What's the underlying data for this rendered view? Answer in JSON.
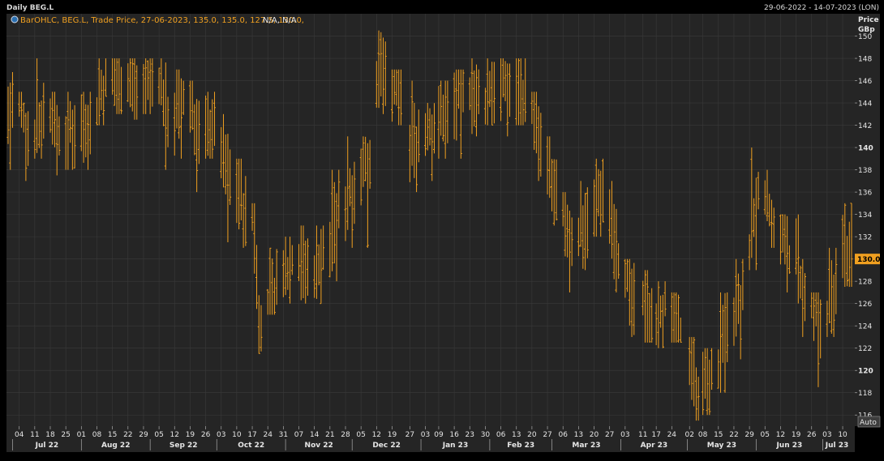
{
  "header": {
    "title": "Daily BEG.L",
    "date_range": "29-06-2022 - 14-07-2023 (LON)"
  },
  "legend": {
    "icon": "chart-settings-icon",
    "text": "BarOHLC, BEG.L, Trade Price, 27-06-2023, 135.0, 135.0, 127.5, 130.0,",
    "na_text": "N/A, N/A"
  },
  "price_axis": {
    "title": "Price",
    "unit": "GBp",
    "last_price_label": "130.0",
    "auto_button": "Auto",
    "bold_ticks": [
      120,
      140
    ]
  },
  "colors": {
    "background": "#000000",
    "plot_bg": "#252525",
    "grid": "#3a3a3a",
    "bar": "#f0a020",
    "text": "#d8d8d8",
    "last_price_bg": "#f0a020"
  },
  "chart_data": {
    "type": "ohlc",
    "title": "Daily BEG.L",
    "ylabel": "Price GBp",
    "ylim": [
      115,
      152
    ],
    "y_ticks": [
      116,
      118,
      120,
      122,
      124,
      126,
      128,
      130,
      132,
      134,
      136,
      138,
      140,
      142,
      144,
      146,
      148,
      150
    ],
    "last_price": 130.0,
    "x_start": "2022-06-29",
    "x_end": "2023-07-14",
    "day_ticks": [
      {
        "date": "2022-07-04",
        "label": "04"
      },
      {
        "date": "2022-07-11",
        "label": "11"
      },
      {
        "date": "2022-07-18",
        "label": "18"
      },
      {
        "date": "2022-07-25",
        "label": "25"
      },
      {
        "date": "2022-08-01",
        "label": "01"
      },
      {
        "date": "2022-08-08",
        "label": "08"
      },
      {
        "date": "2022-08-15",
        "label": "15"
      },
      {
        "date": "2022-08-22",
        "label": "22"
      },
      {
        "date": "2022-08-29",
        "label": "29"
      },
      {
        "date": "2022-09-05",
        "label": "05"
      },
      {
        "date": "2022-09-12",
        "label": "12"
      },
      {
        "date": "2022-09-19",
        "label": "19"
      },
      {
        "date": "2022-09-26",
        "label": "26"
      },
      {
        "date": "2022-10-03",
        "label": "03"
      },
      {
        "date": "2022-10-10",
        "label": "10"
      },
      {
        "date": "2022-10-17",
        "label": "17"
      },
      {
        "date": "2022-10-24",
        "label": "24"
      },
      {
        "date": "2022-10-31",
        "label": "31"
      },
      {
        "date": "2022-11-07",
        "label": "07"
      },
      {
        "date": "2022-11-14",
        "label": "14"
      },
      {
        "date": "2022-11-21",
        "label": "21"
      },
      {
        "date": "2022-11-28",
        "label": "28"
      },
      {
        "date": "2022-12-05",
        "label": "05"
      },
      {
        "date": "2022-12-12",
        "label": "12"
      },
      {
        "date": "2022-12-19",
        "label": "19"
      },
      {
        "date": "2022-12-27",
        "label": "27"
      },
      {
        "date": "2023-01-03",
        "label": "03"
      },
      {
        "date": "2023-01-09",
        "label": "09"
      },
      {
        "date": "2023-01-16",
        "label": "16"
      },
      {
        "date": "2023-01-23",
        "label": "23"
      },
      {
        "date": "2023-01-30",
        "label": "30"
      },
      {
        "date": "2023-02-06",
        "label": "06"
      },
      {
        "date": "2023-02-13",
        "label": "13"
      },
      {
        "date": "2023-02-20",
        "label": "20"
      },
      {
        "date": "2023-02-27",
        "label": "27"
      },
      {
        "date": "2023-03-06",
        "label": "06"
      },
      {
        "date": "2023-03-13",
        "label": "13"
      },
      {
        "date": "2023-03-20",
        "label": "20"
      },
      {
        "date": "2023-03-27",
        "label": "27"
      },
      {
        "date": "2023-04-03",
        "label": "03"
      },
      {
        "date": "2023-04-11",
        "label": "11"
      },
      {
        "date": "2023-04-17",
        "label": "17"
      },
      {
        "date": "2023-04-24",
        "label": "24"
      },
      {
        "date": "2023-05-02",
        "label": "02"
      },
      {
        "date": "2023-05-08",
        "label": "08"
      },
      {
        "date": "2023-05-15",
        "label": "15"
      },
      {
        "date": "2023-05-22",
        "label": "22"
      },
      {
        "date": "2023-05-29",
        "label": "29"
      },
      {
        "date": "2023-06-05",
        "label": "05"
      },
      {
        "date": "2023-06-12",
        "label": "12"
      },
      {
        "date": "2023-06-19",
        "label": "19"
      },
      {
        "date": "2023-06-26",
        "label": "26"
      },
      {
        "date": "2023-07-03",
        "label": "03"
      },
      {
        "date": "2023-07-10",
        "label": "10"
      }
    ],
    "month_ticks": [
      {
        "date": "2022-07-01",
        "label": "Jul 22"
      },
      {
        "date": "2022-08-01",
        "label": "Aug 22"
      },
      {
        "date": "2022-09-01",
        "label": "Sep 22"
      },
      {
        "date": "2022-10-01",
        "label": "Oct 22"
      },
      {
        "date": "2022-11-01",
        "label": "Nov 22"
      },
      {
        "date": "2022-12-01",
        "label": "Dec 22"
      },
      {
        "date": "2023-01-01",
        "label": "Jan 23"
      },
      {
        "date": "2023-02-01",
        "label": "Feb 23"
      },
      {
        "date": "2023-03-01",
        "label": "Mar 23"
      },
      {
        "date": "2023-04-01",
        "label": "Apr 23"
      },
      {
        "date": "2023-05-01",
        "label": "May 23"
      },
      {
        "date": "2023-06-01",
        "label": "Jun 23"
      },
      {
        "date": "2023-07-01",
        "label": "Jul 23"
      }
    ],
    "weekly_ohlc": [
      {
        "week": "2022-06-27",
        "open": 142,
        "high": 148,
        "low": 138,
        "close": 144
      },
      {
        "week": "2022-07-04",
        "open": 144,
        "high": 145,
        "low": 137,
        "close": 141
      },
      {
        "week": "2022-07-11",
        "open": 141,
        "high": 148,
        "low": 139,
        "close": 143
      },
      {
        "week": "2022-07-18",
        "open": 143,
        "high": 145,
        "low": 137.5,
        "close": 141
      },
      {
        "week": "2022-07-25",
        "open": 141,
        "high": 145,
        "low": 138,
        "close": 142
      },
      {
        "week": "2022-08-01",
        "open": 142,
        "high": 145,
        "low": 138,
        "close": 143
      },
      {
        "week": "2022-08-08",
        "open": 143,
        "high": 148,
        "low": 142,
        "close": 146
      },
      {
        "week": "2022-08-15",
        "open": 146,
        "high": 148,
        "low": 143,
        "close": 146
      },
      {
        "week": "2022-08-22",
        "open": 146,
        "high": 148,
        "low": 142.5,
        "close": 145
      },
      {
        "week": "2022-08-29",
        "open": 145,
        "high": 148,
        "low": 143,
        "close": 146
      },
      {
        "week": "2022-09-05",
        "open": 146,
        "high": 148,
        "low": 138,
        "close": 143
      },
      {
        "week": "2022-09-12",
        "open": 143,
        "high": 147,
        "low": 139,
        "close": 144
      },
      {
        "week": "2022-09-19",
        "open": 144,
        "high": 146,
        "low": 136,
        "close": 141
      },
      {
        "week": "2022-09-26",
        "open": 141,
        "high": 145,
        "low": 139,
        "close": 143
      },
      {
        "week": "2022-10-03",
        "open": 140,
        "high": 143,
        "low": 131.5,
        "close": 137
      },
      {
        "week": "2022-10-10",
        "open": 137,
        "high": 139,
        "low": 131,
        "close": 134
      },
      {
        "week": "2022-10-17",
        "open": 134,
        "high": 135,
        "low": 121.5,
        "close": 123
      },
      {
        "week": "2022-10-24",
        "open": 125,
        "high": 131,
        "low": 125,
        "close": 128
      },
      {
        "week": "2022-10-31",
        "open": 128,
        "high": 132,
        "low": 126,
        "close": 130
      },
      {
        "week": "2022-11-07",
        "open": 130,
        "high": 133,
        "low": 126,
        "close": 129
      },
      {
        "week": "2022-11-14",
        "open": 129,
        "high": 133,
        "low": 126,
        "close": 131
      },
      {
        "week": "2022-11-21",
        "open": 131,
        "high": 138,
        "low": 128,
        "close": 135
      },
      {
        "week": "2022-11-28",
        "open": 135,
        "high": 141,
        "low": 131,
        "close": 137
      },
      {
        "week": "2022-12-05",
        "open": 137,
        "high": 141,
        "low": 131,
        "close": 139
      },
      {
        "week": "2022-12-12",
        "open": 146,
        "high": 150.5,
        "low": 143,
        "close": 147
      },
      {
        "week": "2022-12-19",
        "open": 146,
        "high": 147,
        "low": 142,
        "close": 145
      },
      {
        "week": "2022-12-27",
        "open": 140,
        "high": 146,
        "low": 136,
        "close": 141
      },
      {
        "week": "2023-01-03",
        "open": 141,
        "high": 144,
        "low": 137,
        "close": 142
      },
      {
        "week": "2023-01-09",
        "open": 142,
        "high": 146,
        "low": 139,
        "close": 144
      },
      {
        "week": "2023-01-16",
        "open": 144,
        "high": 147,
        "low": 139,
        "close": 145
      },
      {
        "week": "2023-01-23",
        "open": 145,
        "high": 148,
        "low": 141,
        "close": 144
      },
      {
        "week": "2023-01-30",
        "open": 144,
        "high": 148,
        "low": 142,
        "close": 146
      },
      {
        "week": "2023-02-06",
        "open": 146,
        "high": 148,
        "low": 141,
        "close": 145
      },
      {
        "week": "2023-02-13",
        "open": 145,
        "high": 148,
        "low": 142,
        "close": 145
      },
      {
        "week": "2023-02-20",
        "open": 144,
        "high": 145,
        "low": 137,
        "close": 140
      },
      {
        "week": "2023-02-27",
        "open": 138,
        "high": 141,
        "low": 133,
        "close": 135
      },
      {
        "week": "2023-03-06",
        "open": 134,
        "high": 136,
        "low": 127,
        "close": 132
      },
      {
        "week": "2023-03-13",
        "open": 132,
        "high": 137,
        "low": 129,
        "close": 134
      },
      {
        "week": "2023-03-20",
        "open": 134,
        "high": 139,
        "low": 132,
        "close": 137
      },
      {
        "week": "2023-03-27",
        "open": 134,
        "high": 137,
        "low": 127,
        "close": 130
      },
      {
        "week": "2023-04-03",
        "open": 129,
        "high": 130,
        "low": 123,
        "close": 126
      },
      {
        "week": "2023-04-11",
        "open": 126,
        "high": 129,
        "low": 122.5,
        "close": 125
      },
      {
        "week": "2023-04-17",
        "open": 125,
        "high": 128,
        "low": 122,
        "close": 126
      },
      {
        "week": "2023-04-24",
        "open": 124,
        "high": 127,
        "low": 122.5,
        "close": 123
      },
      {
        "week": "2023-05-02",
        "open": 122,
        "high": 123,
        "low": 115.5,
        "close": 118
      },
      {
        "week": "2023-05-08",
        "open": 118,
        "high": 122,
        "low": 116,
        "close": 120
      },
      {
        "week": "2023-05-15",
        "open": 120,
        "high": 127,
        "low": 118,
        "close": 124
      },
      {
        "week": "2023-05-22",
        "open": 124,
        "high": 130,
        "low": 121,
        "close": 127
      },
      {
        "week": "2023-05-29",
        "open": 130,
        "high": 140,
        "low": 129,
        "close": 136
      },
      {
        "week": "2023-06-05",
        "open": 136,
        "high": 138,
        "low": 131,
        "close": 133
      },
      {
        "week": "2023-06-12",
        "open": 133,
        "high": 134,
        "low": 127,
        "close": 130
      },
      {
        "week": "2023-06-19",
        "open": 130,
        "high": 134,
        "low": 123,
        "close": 126
      },
      {
        "week": "2023-06-26",
        "open": 126,
        "high": 127,
        "low": 118.5,
        "close": 124
      },
      {
        "week": "2023-07-03",
        "open": 125,
        "high": 131,
        "low": 123,
        "close": 128
      },
      {
        "week": "2023-07-10",
        "open": 131,
        "high": 135,
        "low": 127.5,
        "close": 130
      }
    ]
  }
}
